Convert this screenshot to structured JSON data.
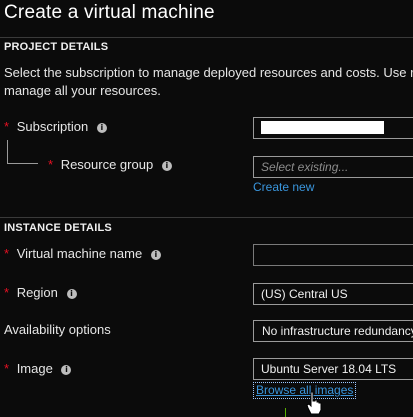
{
  "page": {
    "title": "Create a virtual machine"
  },
  "project": {
    "header": "PROJECT DETAILS",
    "description_line1": "Select the subscription to manage deployed resources and costs. Use re",
    "description_line2": "manage all your resources.",
    "subscription": {
      "required": "*",
      "label": "Subscription"
    },
    "resource_group": {
      "required": "*",
      "label": "Resource group",
      "placeholder": "Select existing...",
      "create_new": "Create new"
    }
  },
  "instance": {
    "header": "INSTANCE DETAILS",
    "vm_name": {
      "required": "*",
      "label": "Virtual machine name",
      "value": ""
    },
    "region": {
      "required": "*",
      "label": "Region",
      "value": "(US) Central US"
    },
    "availability": {
      "label": "Availability options",
      "value": "No infrastructure redundancy"
    },
    "image": {
      "required": "*",
      "label": "Image",
      "value": "Ubuntu Server 18.04 LTS",
      "browse": "Browse all images"
    }
  },
  "icons": {
    "info": "i"
  },
  "colors": {
    "background": "#0b0b0b",
    "required": "#e81123",
    "link": "#3a96dd"
  }
}
